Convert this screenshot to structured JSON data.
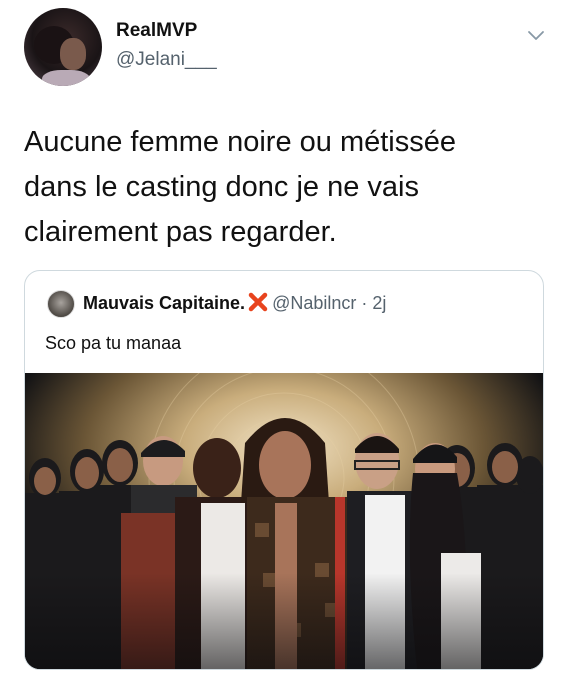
{
  "tweet": {
    "display_name": "RealMVP",
    "handle": "@Jelani___",
    "text": "Aucune femme noire ou métissée\ndans le casting donc je ne vais\nclairement pas regarder."
  },
  "quoted_tweet": {
    "display_name": "Mauvais Capitaine.",
    "handle": "@Nabilncr",
    "separator": "·",
    "time": "2j",
    "text": "Sco pa tu manaa"
  },
  "icons": {
    "menu": "chevron-down-icon",
    "badge": "red-x-icon"
  },
  "colors": {
    "text": "#0f1419",
    "secondary": "#55626d",
    "border": "#cfd9de",
    "badge": "#e8441e"
  }
}
